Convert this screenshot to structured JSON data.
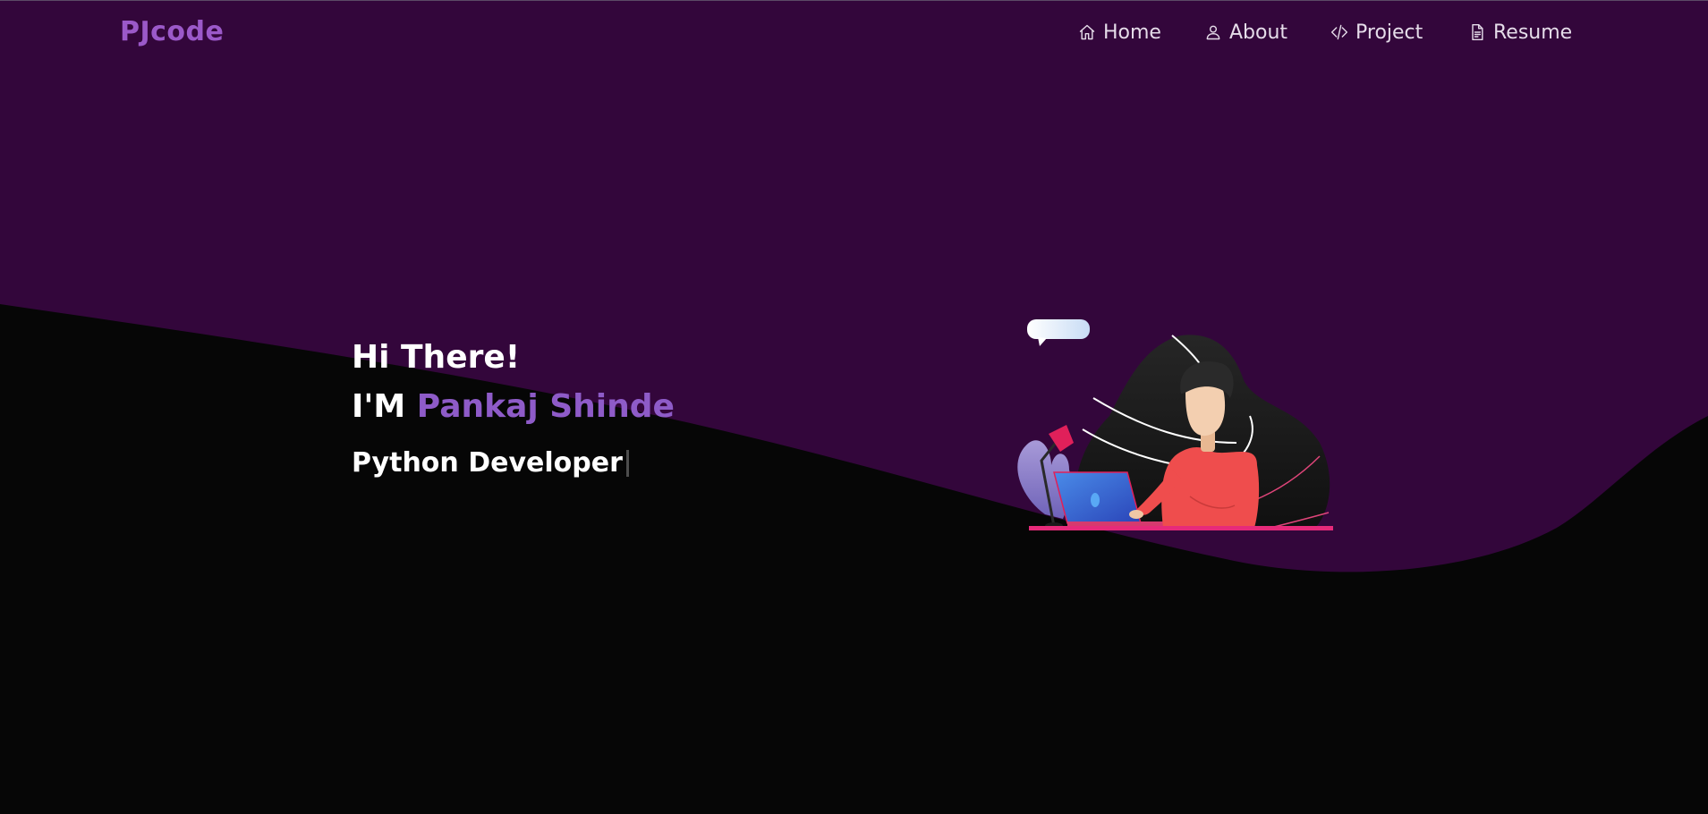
{
  "colors": {
    "hero_background": "#33063b",
    "page_background": "#060606",
    "brand": "#9b59c9",
    "name_highlight": "#8e5bc8",
    "nav_text": "#e5dce9"
  },
  "navbar": {
    "brand": "PJcode",
    "links": [
      {
        "label": "Home",
        "icon": "home-icon"
      },
      {
        "label": "About",
        "icon": "user-icon"
      },
      {
        "label": "Project",
        "icon": "code-icon"
      },
      {
        "label": "Resume",
        "icon": "document-icon"
      }
    ]
  },
  "hero": {
    "greeting": "Hi There!",
    "intro_prefix": "I'M",
    "name": "Pankaj Shinde",
    "typed_role": "Python Developer"
  },
  "illustration": {
    "description_icon": "developer-at-laptop-illustration"
  }
}
